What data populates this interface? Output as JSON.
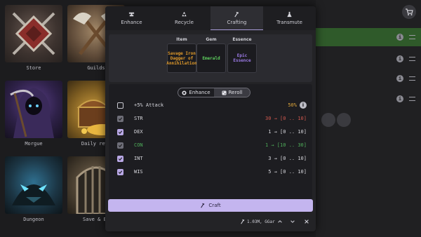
{
  "background": {
    "tiles": [
      {
        "label": "Store"
      },
      {
        "label": "Guilds"
      },
      {
        "label": "Morgue"
      },
      {
        "label": "Daily rewa"
      },
      {
        "label": "Dungeon"
      },
      {
        "label": "Save & Ex"
      }
    ],
    "icons": {
      "cart": "shopping-cart-icon"
    }
  },
  "tabs": [
    {
      "label": "Enhance",
      "icon": "anvil-icon"
    },
    {
      "label": "Recycle",
      "icon": "recycle-icon"
    },
    {
      "label": "Crafting",
      "icon": "hammer-icon",
      "active": true
    },
    {
      "label": "Transmute",
      "icon": "flask-icon"
    }
  ],
  "slots": {
    "item": {
      "header": "Item",
      "text": "Savage Iron Dagger of Annihilation",
      "color": "#e09a2b"
    },
    "gem": {
      "header": "Gem",
      "text": "Emerald",
      "color": "#5fd35f"
    },
    "essence": {
      "header": "Essence",
      "text": "Epic Essence",
      "color": "#9d7be8"
    }
  },
  "mode_toggle": {
    "enhance": "Enhance",
    "reroll": "Reroll",
    "selected": "Reroll"
  },
  "affixes": [
    {
      "name": "+5% Attack",
      "value": "50%",
      "state": "unchecked",
      "name_color": "#d6d6dc",
      "value_color": "#e0a73a"
    },
    {
      "name": "STR",
      "value": "30 → [0 .. 10]",
      "state": "disabled",
      "name_color": "#d6d6dc",
      "value_color": "#d0584e"
    },
    {
      "name": "DEX",
      "value": "1 → [0 .. 10]",
      "state": "checked",
      "name_color": "#d6d6dc",
      "value_color": "#d6d6dc"
    },
    {
      "name": "CON",
      "value": "1 → [10 .. 30]",
      "state": "disabled",
      "name_color": "#4fae5a",
      "value_color": "#4fae5a"
    },
    {
      "name": "INT",
      "value": "3 → [0 .. 10]",
      "state": "checked",
      "name_color": "#d6d6dc",
      "value_color": "#d6d6dc"
    },
    {
      "name": "WIS",
      "value": "5 → [0 .. 10]",
      "state": "checked",
      "name_color": "#d6d6dc",
      "value_color": "#d6d6dc"
    }
  ],
  "craft_button": "Craft",
  "footer": {
    "cost": "1.03M, GGar"
  },
  "colors": {
    "accent": "#c4b5ef",
    "selected_row": "#2f5a2a"
  }
}
